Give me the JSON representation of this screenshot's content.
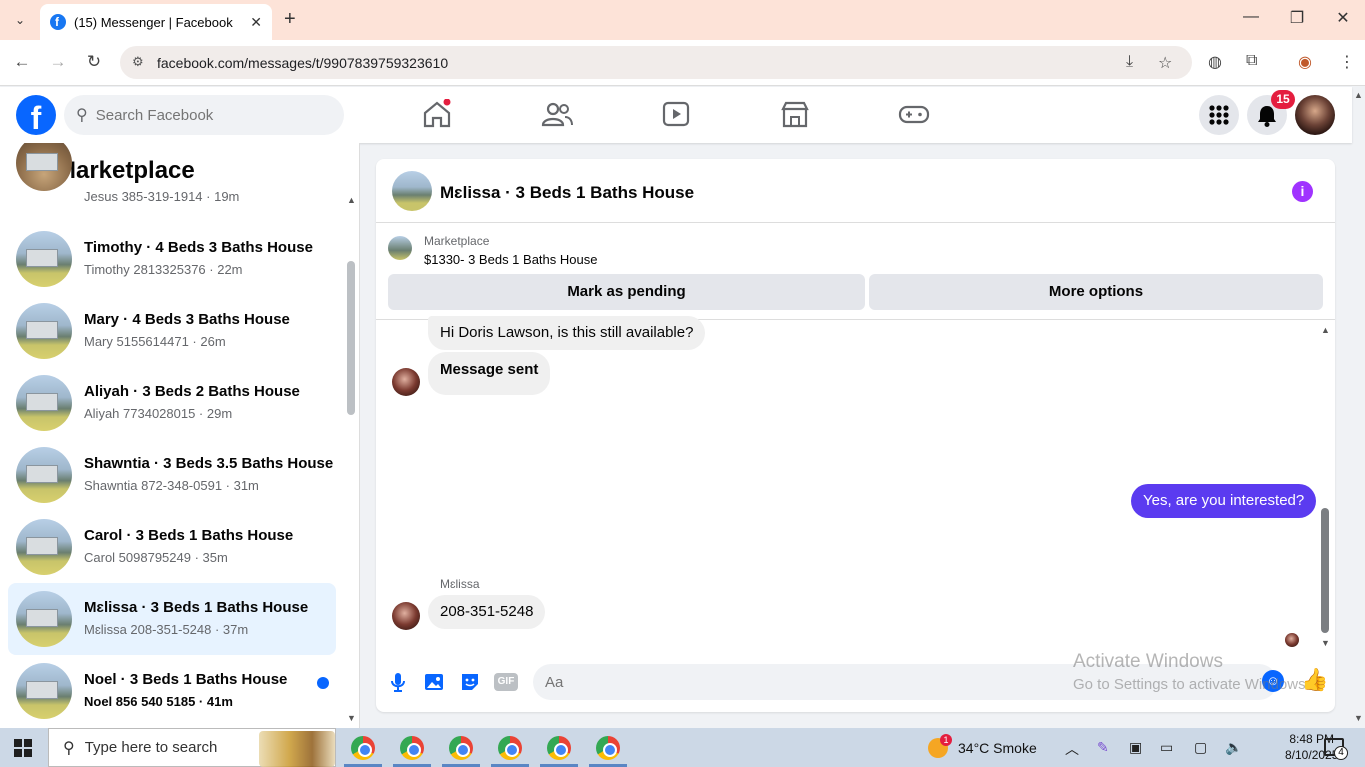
{
  "browser": {
    "tab_title": "(15) Messenger | Facebook",
    "tab_close": "✕",
    "new_tab": "+",
    "url": "facebook.com/messages/t/9907839759323610"
  },
  "header": {
    "search_placeholder": "Search Facebook",
    "notification_count": "15",
    "accent_color": "#0866ff"
  },
  "sidebar": {
    "title": "Marketplace",
    "conversations": [
      {
        "title": "",
        "subtitle": "Jesus 385-319-1914 · 19m",
        "active": false,
        "unread": false
      },
      {
        "title": "Timothy · 4 Beds 3 Baths House",
        "subtitle": "Timothy 2813325376 · 22m",
        "active": false,
        "unread": false
      },
      {
        "title": "Mary · 4 Beds 3 Baths House",
        "subtitle": "Mary 5155614471 · 26m",
        "active": false,
        "unread": false
      },
      {
        "title": "Aliyah · 3 Beds 2 Baths House",
        "subtitle": "Aliyah 7734028015 · 29m",
        "active": false,
        "unread": false
      },
      {
        "title": "Shawntia · 3 Beds 3.5 Baths House",
        "subtitle": "Shawntia 872-348-0591 · 31m",
        "active": false,
        "unread": false
      },
      {
        "title": "Carol · 3 Beds 1 Baths House",
        "subtitle": "Carol 5098795249 · 35m",
        "active": false,
        "unread": false
      },
      {
        "title": "Mɛlissa · 3 Beds 1 Baths House",
        "subtitle": "Mɛlissa 208-351-5248 · 37m",
        "active": true,
        "unread": false
      },
      {
        "title": "Noel · 3 Beds 1 Baths House",
        "subtitle": "Noel 856 540 5185 · 41m",
        "active": false,
        "unread": true
      }
    ]
  },
  "chat": {
    "title": "Mɛlissa · 3 Beds 1 Baths House",
    "listing_label": "Marketplace",
    "listing_price": "$1330- 3 Beds 1 Baths House",
    "mark_pending_label": "Mark as pending",
    "more_options_label": "More options",
    "messages": {
      "m1": "Hi Doris Lawson, is this still available?",
      "m2": "Message sent",
      "m3": "Yes, are you interested?",
      "m4": "208-351-5248"
    },
    "sender_name": "Mɛlissa",
    "composer_placeholder": "Aa",
    "gif_label": "GIF",
    "my_bubble_color": "#5b3bf0"
  },
  "watermark": {
    "line1": "Activate Windows",
    "line2": "Go to Settings to activate Windows."
  },
  "taskbar": {
    "search_placeholder": "Type here to search",
    "weather": "34°C  Smoke",
    "weather_badge": "1",
    "time": "8:48 PM",
    "date": "8/10/2025",
    "notification_count": "4"
  }
}
